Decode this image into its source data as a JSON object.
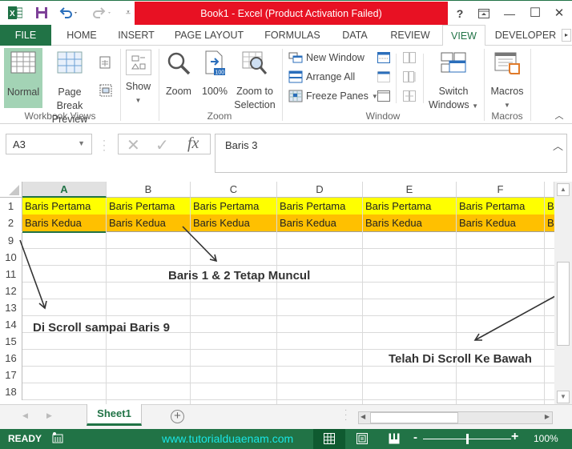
{
  "titlebar": {
    "title": "Book1 -  Excel (Product Activation Failed)",
    "help": "?",
    "minimize": "—",
    "restore": "☐",
    "close": "✕"
  },
  "tabs": [
    {
      "label": "FILE"
    },
    {
      "label": "HOME"
    },
    {
      "label": "INSERT"
    },
    {
      "label": "PAGE LAYOUT"
    },
    {
      "label": "FORMULAS"
    },
    {
      "label": "DATA"
    },
    {
      "label": "REVIEW"
    },
    {
      "label": "VIEW"
    },
    {
      "label": "DEVELOPER"
    }
  ],
  "ribbon": {
    "workbook_views": {
      "label": "Workbook Views",
      "normal": "Normal",
      "page_break_1": "Page Break",
      "page_break_2": "Preview"
    },
    "show": {
      "label": "Show"
    },
    "zoom": {
      "label": "Zoom",
      "zoom": "Zoom",
      "hundred": "100%",
      "zoom_sel_1": "Zoom to",
      "zoom_sel_2": "Selection"
    },
    "window": {
      "label": "Window",
      "new_window": "New Window",
      "arrange_all": "Arrange All",
      "freeze_panes": "Freeze Panes",
      "switch_1": "Switch",
      "switch_2": "Windows"
    },
    "macros": {
      "label": "Macros",
      "macros": "Macros"
    }
  },
  "formula_bar": {
    "name_box": "A3",
    "fx": "fx",
    "content": "Baris 3"
  },
  "grid": {
    "columns": [
      "A",
      "B",
      "C",
      "D",
      "E",
      "F"
    ],
    "selected_column": "A",
    "frozen_rows": [
      {
        "row": "1",
        "cells": [
          "Baris Pertama",
          "Baris Pertama",
          "Baris Pertama",
          "Baris Pertama",
          "Baris Pertama",
          "Baris Pertama",
          "Ba"
        ],
        "fill": "#ffff00"
      },
      {
        "row": "2",
        "cells": [
          "Baris Kedua",
          "Baris Kedua",
          "Baris Kedua",
          "Baris Kedua",
          "Baris Kedua",
          "Baris Kedua",
          "Ba"
        ],
        "fill": "#ffc000"
      }
    ],
    "scrolled_rows": [
      "9",
      "10",
      "11",
      "12",
      "13",
      "14",
      "15",
      "16",
      "17",
      "18"
    ]
  },
  "annotations": {
    "frozen": "Baris 1 & 2 Tetap Muncul",
    "scrolled_to": "Di Scroll sampai Baris 9",
    "scrolled_down": "Telah Di Scroll Ke Bawah"
  },
  "sheets": {
    "active": "Sheet1",
    "add": "+"
  },
  "status": {
    "ready": "READY",
    "watermark": "www.tutorialduaenam.com",
    "zoom_level": "100%",
    "zoom_percent": 100
  }
}
